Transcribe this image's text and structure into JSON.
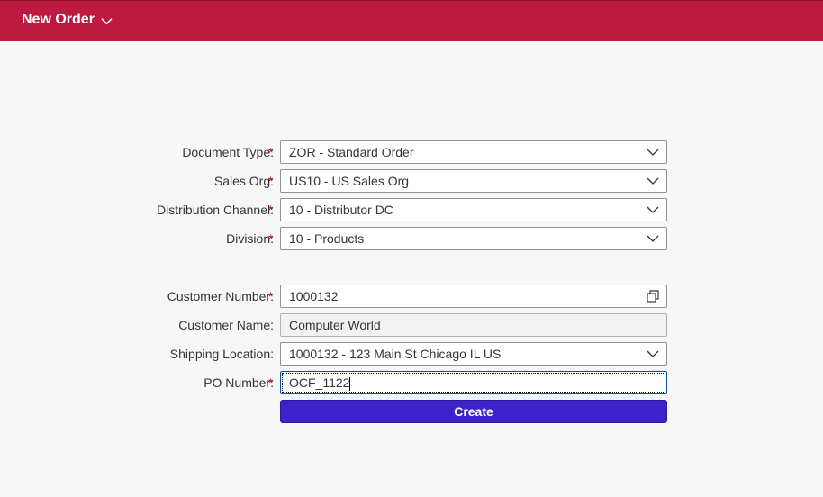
{
  "app": {
    "title": "New Order"
  },
  "form": {
    "document_type": {
      "label": "Document Type:",
      "value": "ZOR - Standard Order"
    },
    "sales_org": {
      "label": "Sales Org:",
      "value": "US10 - US Sales Org"
    },
    "distribution_channel": {
      "label": "Distribution Channel:",
      "value": "10 - Distributor DC"
    },
    "division": {
      "label": "Division:",
      "value": "10 - Products"
    },
    "customer_number": {
      "label": "Customer Number:",
      "value": "1000132"
    },
    "customer_name": {
      "label": "Customer Name:",
      "value": "Computer World"
    },
    "shipping_location": {
      "label": "Shipping Location:",
      "value": "1000132 - 123 Main St Chicago IL US"
    },
    "po_number": {
      "label": "PO Number:",
      "value": "OCF_1122"
    },
    "required_marker": "*"
  },
  "actions": {
    "create_label": "Create"
  },
  "colors": {
    "header": "#be193f",
    "primary_button": "#3f21c8",
    "required": "#bb0000"
  }
}
